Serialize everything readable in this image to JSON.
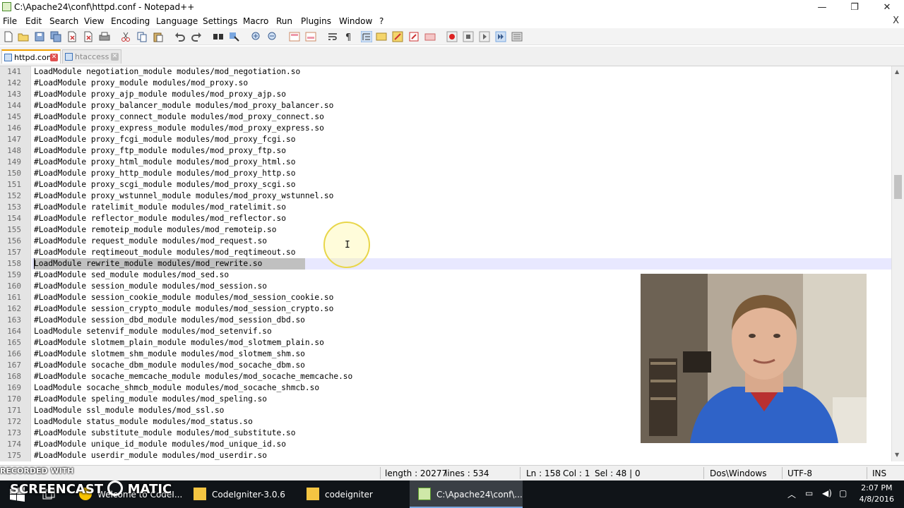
{
  "window": {
    "title": "C:\\Apache24\\conf\\httpd.conf - Notepad++",
    "minimize": "—",
    "maximize": "❐",
    "close": "✕"
  },
  "menu": {
    "items": [
      "File",
      "Edit",
      "Search",
      "View",
      "Encoding",
      "Language",
      "Settings",
      "Macro",
      "Run",
      "Plugins",
      "Window",
      "?"
    ],
    "close_doc": "X"
  },
  "toolbar": {
    "icons": [
      "new-file-icon",
      "open-file-icon",
      "save-icon",
      "save-all-icon",
      "close-icon",
      "close-all-icon",
      "print-icon",
      "cut-icon",
      "copy-icon",
      "paste-icon",
      "undo-icon",
      "redo-icon",
      "find-icon",
      "replace-icon",
      "zoom-in-icon",
      "zoom-out-icon",
      "sync-vertical-icon",
      "sync-horizontal-icon",
      "word-wrap-icon",
      "show-all-chars-icon",
      "indent-guide-icon",
      "doc-map-icon",
      "function-list-icon",
      "folder-workspace-icon",
      "monitoring-icon",
      "record-macro-icon",
      "stop-macro-icon",
      "play-macro-icon",
      "run-macro-multiple-icon",
      "save-macro-icon"
    ]
  },
  "tabs": [
    {
      "label": "httpd.conf",
      "active": true
    },
    {
      "label": "htaccess",
      "active": false
    }
  ],
  "editor": {
    "first_line_number": 141,
    "current_line": 158,
    "lines": [
      "LoadModule negotiation_module modules/mod_negotiation.so",
      "#LoadModule proxy_module modules/mod_proxy.so",
      "#LoadModule proxy_ajp_module modules/mod_proxy_ajp.so",
      "#LoadModule proxy_balancer_module modules/mod_proxy_balancer.so",
      "#LoadModule proxy_connect_module modules/mod_proxy_connect.so",
      "#LoadModule proxy_express_module modules/mod_proxy_express.so",
      "#LoadModule proxy_fcgi_module modules/mod_proxy_fcgi.so",
      "#LoadModule proxy_ftp_module modules/mod_proxy_ftp.so",
      "#LoadModule proxy_html_module modules/mod_proxy_html.so",
      "#LoadModule proxy_http_module modules/mod_proxy_http.so",
      "#LoadModule proxy_scgi_module modules/mod_proxy_scgi.so",
      "#LoadModule proxy_wstunnel_module modules/mod_proxy_wstunnel.so",
      "#LoadModule ratelimit_module modules/mod_ratelimit.so",
      "#LoadModule reflector_module modules/mod_reflector.so",
      "#LoadModule remoteip_module modules/mod_remoteip.so",
      "#LoadModule request_module modules/mod_request.so",
      "#LoadModule reqtimeout_module modules/mod_reqtimeout.so",
      "LoadModule rewrite_module modules/mod_rewrite.so",
      "#LoadModule sed_module modules/mod_sed.so",
      "#LoadModule session_module modules/mod_session.so",
      "#LoadModule session_cookie_module modules/mod_session_cookie.so",
      "#LoadModule session_crypto_module modules/mod_session_crypto.so",
      "#LoadModule session_dbd_module modules/mod_session_dbd.so",
      "LoadModule setenvif_module modules/mod_setenvif.so",
      "#LoadModule slotmem_plain_module modules/mod_slotmem_plain.so",
      "#LoadModule slotmem_shm_module modules/mod_slotmem_shm.so",
      "#LoadModule socache_dbm_module modules/mod_socache_dbm.so",
      "#LoadModule socache_memcache_module modules/mod_socache_memcache.so",
      "LoadModule socache_shmcb_module modules/mod_socache_shmcb.so",
      "#LoadModule speling_module modules/mod_speling.so",
      "LoadModule ssl_module modules/mod_ssl.so",
      "LoadModule status_module modules/mod_status.so",
      "#LoadModule substitute_module modules/mod_substitute.so",
      "#LoadModule unique_id_module modules/mod_unique_id.so",
      "#LoadModule userdir_module modules/mod_userdir.so"
    ]
  },
  "status": {
    "length": "length : 20277",
    "lines": "lines : 534",
    "ln": "Ln : 158",
    "col": "Col : 1",
    "sel": "Sel : 48 | 0",
    "eol": "Dos\\Windows",
    "encoding": "UTF-8",
    "mode": "INS"
  },
  "overlay": {
    "recorded_with": "RECORDED WITH",
    "brand": "SCREENCAST",
    "brand2": "MATIC"
  },
  "taskbar": {
    "tasks": [
      {
        "label": "Welcome to CodeI...",
        "active": false
      },
      {
        "label": "CodeIgniter-3.0.6",
        "active": false
      },
      {
        "label": "codeigniter",
        "active": false
      },
      {
        "label": "C:\\Apache24\\conf\\...",
        "active": true
      }
    ],
    "time": "2:07 PM",
    "date": "4/8/2016"
  },
  "colors": {
    "current_line": "#e8e8ff",
    "selection": "#c0c0c0",
    "active_tab_accent": "#f0a000"
  }
}
